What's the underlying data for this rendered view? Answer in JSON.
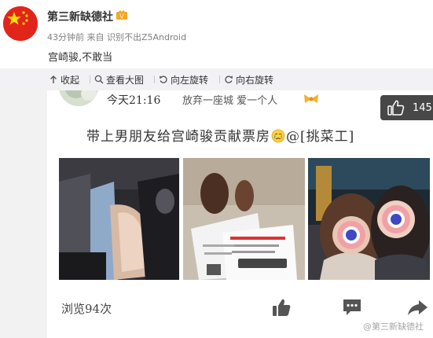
{
  "post": {
    "author": "第三新缺德社",
    "meta": "43分钟前 来自 识别不出Z5Android",
    "text": "宫崎骏,不敢当"
  },
  "toolbar": {
    "collapse": "收起",
    "view_large": "查看大图",
    "rotate_left": "向左旋转",
    "rotate_right": "向右旋转"
  },
  "screenshot": {
    "time": "今天21:16",
    "signature": "放弃一座城 爱一个人",
    "title_main": "带上男朋友给宫崎骏贡献票房",
    "title_mention": "@[挑菜工]",
    "views": "浏览94次",
    "watermark": "@第三新缺德社"
  },
  "floating_like": {
    "count": "145"
  },
  "colors": {
    "flag_red": "#e1251b",
    "flag_star": "#ffde00",
    "toolbar_bg": "#f2f2f5",
    "float_bg": "#000000b8"
  },
  "icons": {
    "collapse": "collapse-arrow-icon",
    "view_large": "magnifier-icon",
    "rotate_left": "rotate-left-icon",
    "rotate_right": "rotate-right-icon",
    "like": "thumbs-up-icon",
    "comment": "comment-icon",
    "share": "share-arrow-icon"
  }
}
